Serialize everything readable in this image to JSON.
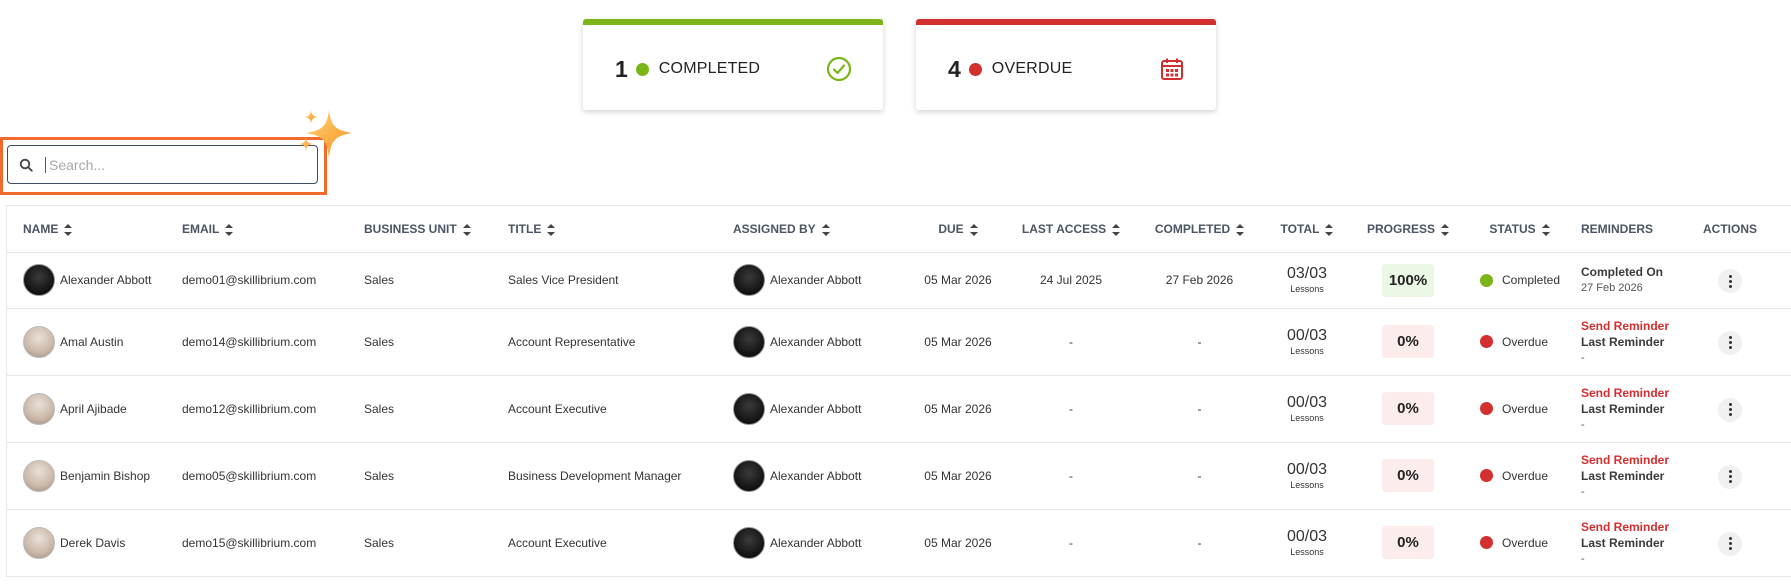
{
  "summary_cards": [
    {
      "count": "1",
      "label": "COMPLETED",
      "color": "#7cb518",
      "icon": "check-circle-icon"
    },
    {
      "count": "4",
      "label": "OVERDUE",
      "color": "#d32f2f",
      "icon": "calendar-icon"
    }
  ],
  "search": {
    "placeholder": "Search..."
  },
  "table": {
    "headers": [
      "NAME",
      "EMAIL",
      "BUSINESS UNIT",
      "TITLE",
      "ASSIGNED BY",
      "DUE",
      "LAST ACCESS",
      "COMPLETED",
      "TOTAL",
      "PROGRESS",
      "STATUS",
      "REMINDERS",
      "ACTIONS"
    ],
    "lessons_label": "Lessons",
    "rows": [
      {
        "name": "Alexander Abbott",
        "email": "demo01@skillibrium.com",
        "unit": "Sales",
        "title": "Sales Vice President",
        "assigned_by": "Alexander Abbott",
        "due": "05 Mar 2026",
        "last_access": "24 Jul 2025",
        "completed": "27 Feb 2026",
        "total": "03/03",
        "progress": "100%",
        "progress_value": 100,
        "status": "Completed",
        "reminder_line1": "Completed On",
        "reminder_line2": "27 Feb 2026",
        "reminder_line3": ""
      },
      {
        "name": "Amal Austin",
        "email": "demo14@skillibrium.com",
        "unit": "Sales",
        "title": "Account Representative",
        "assigned_by": "Alexander Abbott",
        "due": "05 Mar 2026",
        "last_access": "-",
        "completed": "-",
        "total": "00/03",
        "progress": "0%",
        "progress_value": 0,
        "status": "Overdue",
        "reminder_line1": "Send Reminder",
        "reminder_line2": "Last Reminder",
        "reminder_line3": "-"
      },
      {
        "name": "April Ajibade",
        "email": "demo12@skillibrium.com",
        "unit": "Sales",
        "title": "Account Executive",
        "assigned_by": "Alexander Abbott",
        "due": "05 Mar 2026",
        "last_access": "-",
        "completed": "-",
        "total": "00/03",
        "progress": "0%",
        "progress_value": 0,
        "status": "Overdue",
        "reminder_line1": "Send Reminder",
        "reminder_line2": "Last Reminder",
        "reminder_line3": "-"
      },
      {
        "name": "Benjamin Bishop",
        "email": "demo05@skillibrium.com",
        "unit": "Sales",
        "title": "Business Development Manager",
        "assigned_by": "Alexander Abbott",
        "due": "05 Mar 2026",
        "last_access": "-",
        "completed": "-",
        "total": "00/03",
        "progress": "0%",
        "progress_value": 0,
        "status": "Overdue",
        "reminder_line1": "Send Reminder",
        "reminder_line2": "Last Reminder",
        "reminder_line3": "-"
      },
      {
        "name": "Derek Davis",
        "email": "demo15@skillibrium.com",
        "unit": "Sales",
        "title": "Account Executive",
        "assigned_by": "Alexander Abbott",
        "due": "05 Mar 2026",
        "last_access": "-",
        "completed": "-",
        "total": "00/03",
        "progress": "0%",
        "progress_value": 0,
        "status": "Overdue",
        "reminder_line1": "Send Reminder",
        "reminder_line2": "Last Reminder",
        "reminder_line3": "-"
      }
    ]
  },
  "colors": {
    "completed": "#7cb518",
    "overdue": "#d32f2f",
    "progress_complete_bg": "#edf7e6",
    "progress_zero_bg": "#fdecec",
    "highlight": "#f26a2e"
  }
}
